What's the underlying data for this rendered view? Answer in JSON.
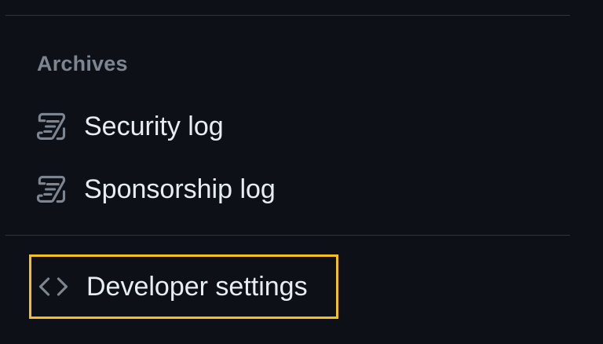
{
  "sidebar": {
    "archives_heading": "Archives",
    "items": [
      {
        "label": "Security log",
        "icon": "log-icon"
      },
      {
        "label": "Sponsorship log",
        "icon": "log-icon"
      },
      {
        "label": "Developer settings",
        "icon": "code-icon"
      }
    ],
    "highlight_color": "#f5c01e"
  }
}
